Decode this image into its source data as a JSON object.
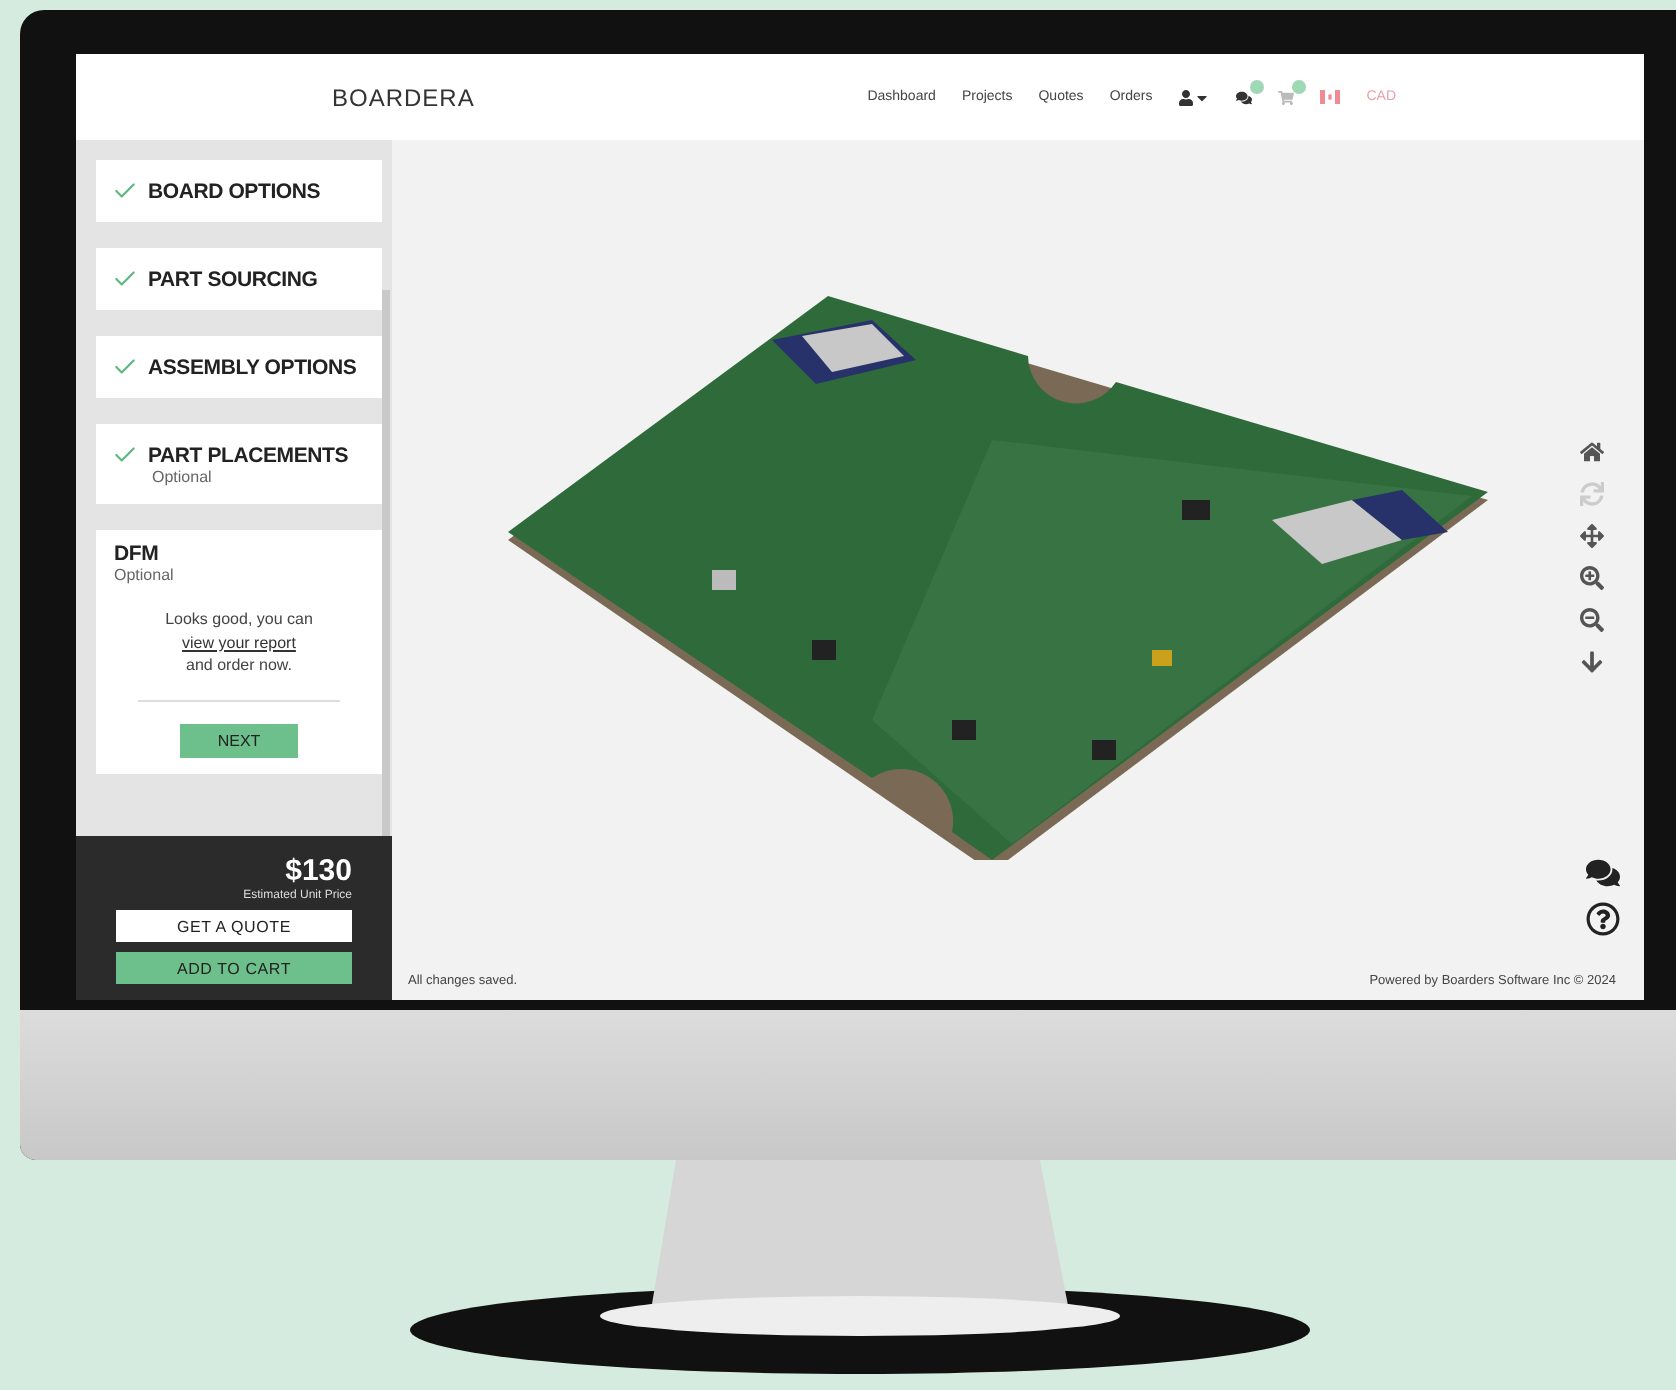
{
  "logo": "BOARDERA",
  "nav": [
    {
      "label": "Dashboard"
    },
    {
      "label": "Projects"
    },
    {
      "label": "Quotes"
    },
    {
      "label": "Orders"
    }
  ],
  "currency": "CAD",
  "steps": [
    {
      "title": "BOARD OPTIONS",
      "completed": true
    },
    {
      "title": "PART SOURCING",
      "completed": true
    },
    {
      "title": "ASSEMBLY OPTIONS",
      "completed": true
    },
    {
      "title": "PART PLACEMENTS",
      "completed": true,
      "subtitle": "Optional"
    }
  ],
  "dfm": {
    "title": "DFM",
    "subtitle": "Optional",
    "message_before": "Looks good, you can",
    "link": "view your report",
    "message_after": "and order now.",
    "button": "NEXT"
  },
  "price": {
    "amount": "$130",
    "label": "Estimated Unit Price"
  },
  "actions": [
    {
      "label": "GET A QUOTE",
      "kind": "outline"
    },
    {
      "label": "ADD TO CART",
      "kind": "primary"
    }
  ],
  "status": "All changes saved.",
  "credit": "Powered by Boarders Software Inc © 2024"
}
